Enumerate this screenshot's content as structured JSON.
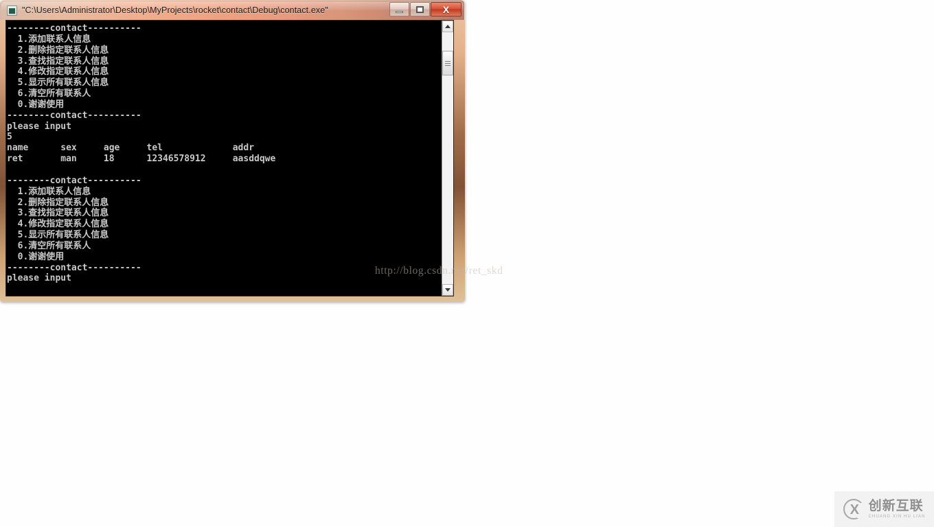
{
  "window": {
    "title": "\"C:\\Users\\Administrator\\Desktop\\MyProjects\\rocket\\contact\\Debug\\contact.exe\"",
    "icon": "console-app-icon",
    "buttons": {
      "minimize_label": "—",
      "maximize_label": "□",
      "close_label": "X"
    }
  },
  "console": {
    "separator": "--------contact----------",
    "menu": [
      "  1.添加联系人信息",
      "  2.删除指定联系人信息",
      "  3.查找指定联系人信息",
      "  4.修改指定联系人信息",
      "  5.显示所有联系人信息",
      "  6.清空所有联系人",
      "  0.谢谢使用"
    ],
    "prompt": "please input",
    "user_input": "5",
    "table": {
      "headers": [
        "name",
        "sex",
        "age",
        "tel",
        "addr"
      ],
      "rows": [
        [
          "ret",
          "man",
          "18",
          "12346578912",
          "aasddqwe"
        ]
      ]
    },
    "output": "--------contact----------\n  1.添加联系人信息\n  2.删除指定联系人信息\n  3.查找指定联系人信息\n  4.修改指定联系人信息\n  5.显示所有联系人信息\n  6.清空所有联系人\n  0.谢谢使用\n--------contact----------\nplease input\n5\nname      sex     age     tel             addr\nret       man     18      12346578912     aasddqwe\n\n--------contact----------\n  1.添加联系人信息\n  2.删除指定联系人信息\n  3.查找指定联系人信息\n  4.修改指定联系人信息\n  5.显示所有联系人信息\n  6.清空所有联系人\n  0.谢谢使用\n--------contact----------\nplease input",
    "scrollbar": {
      "up_arrow": "scroll-up-icon",
      "down_arrow": "scroll-down-icon"
    }
  },
  "watermark": {
    "text": "http://blog.csdn.net/ret_skd"
  },
  "brand": {
    "chinese": "创新互联",
    "pinyin": "CHUANG XIN HU LIAN",
    "mark_letter": "X"
  },
  "colors": {
    "console_bg": "#000000",
    "console_fg": "#c8c8c8",
    "frame": "#d8b48c",
    "close_button": "#c03b22",
    "page_bg": "#ffffff"
  }
}
